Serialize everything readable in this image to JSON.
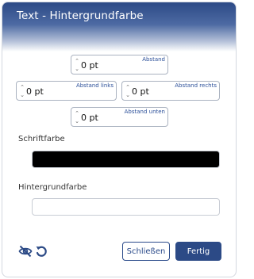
{
  "dialog": {
    "title": "Text - Hintergrundfarbe"
  },
  "spacing": {
    "top": {
      "caption": "Abstand",
      "value": "0 pt"
    },
    "left": {
      "caption": "Abstand links",
      "value": "0 pt"
    },
    "right": {
      "caption": "Abstand rechts",
      "value": "0 pt"
    },
    "bottom": {
      "caption": "Abstand unten",
      "value": "0 pt"
    }
  },
  "font_color": {
    "label": "Schriftfarbe",
    "color": "#000000"
  },
  "background_color": {
    "label": "Hintergrundfarbe",
    "color": "#ffffff"
  },
  "footer": {
    "close_label": "Schließen",
    "done_label": "Fertig",
    "hide_icon": "eye-slash-icon",
    "reset_icon": "undo-icon"
  },
  "colors": {
    "accent": "#2c4a86",
    "caption": "#2b4f99"
  }
}
